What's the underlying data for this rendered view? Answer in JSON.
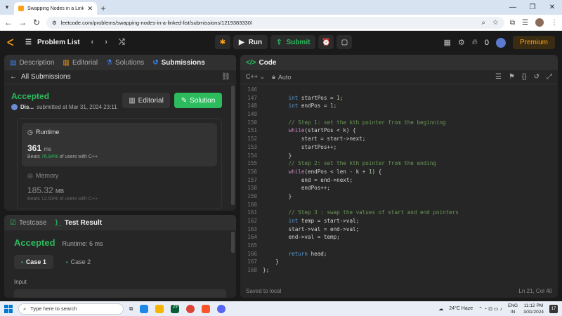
{
  "browser": {
    "tab_title": "Swapping Nodes in a Linked Lis",
    "url": "leetcode.com/problems/swapping-nodes-in-a-linked-list/submissions/1219383330/"
  },
  "topbar": {
    "problem_list": "Problem List",
    "run": "Run",
    "submit": "Submit",
    "streak": "0",
    "premium": "Premium"
  },
  "left_tabs": [
    "Description",
    "Editorial",
    "Solutions",
    "Submissions"
  ],
  "submission": {
    "all_label": "All Submissions",
    "status": "Accepted",
    "user": "Dis...",
    "submitted": "submitted at Mar 31, 2024 23:11",
    "editorial_btn": "Editorial",
    "solution_btn": "Solution",
    "runtime_label": "Runtime",
    "runtime_value": "361",
    "runtime_unit": "ms",
    "runtime_beats_pre": "Beats",
    "runtime_beats": "76.84%",
    "runtime_beats_post": "of users with C++",
    "memory_label": "Memory",
    "memory_value": "185.32",
    "memory_unit": "MB",
    "memory_beats_pre": "Beats",
    "memory_beats": "12.63%",
    "memory_beats_post": "of users with C++"
  },
  "bottom": {
    "tab_testcase": "Testcase",
    "tab_result": "Test Result",
    "status": "Accepted",
    "runtime": "Runtime: 6 ms",
    "case1": "Case 1",
    "case2": "Case 2",
    "input_label": "Input"
  },
  "code_panel": {
    "title": "Code",
    "language": "C++",
    "mode": "Auto",
    "saved": "Saved to local",
    "cursor": "Ln 21, Col 40",
    "lines": [
      {
        "n": "146",
        "t": ""
      },
      {
        "n": "147",
        "t": "        int startPos = 1;"
      },
      {
        "n": "148",
        "t": "        int endPos = 1;"
      },
      {
        "n": "149",
        "t": ""
      },
      {
        "n": "150",
        "t": "        // Step 1: set the kth pointer from the beginning"
      },
      {
        "n": "151",
        "t": "        while(startPos < k) {"
      },
      {
        "n": "152",
        "t": "            start = start->next;"
      },
      {
        "n": "153",
        "t": "            startPos++;"
      },
      {
        "n": "154",
        "t": "        }"
      },
      {
        "n": "155",
        "t": "        // Step 2: set the kth pointer from the ending"
      },
      {
        "n": "156",
        "t": "        while(endPos < len - k + 1) {"
      },
      {
        "n": "157",
        "t": "            end = end->next;"
      },
      {
        "n": "158",
        "t": "            endPos++;"
      },
      {
        "n": "159",
        "t": "        }"
      },
      {
        "n": "160",
        "t": ""
      },
      {
        "n": "161",
        "t": "        // Step 3 : swap the values of start and end pointers"
      },
      {
        "n": "162",
        "t": "        int temp = start->val;"
      },
      {
        "n": "163",
        "t": "        start->val = end->val;"
      },
      {
        "n": "164",
        "t": "        end->val = temp;"
      },
      {
        "n": "165",
        "t": ""
      },
      {
        "n": "166",
        "t": "        return head;"
      },
      {
        "n": "167",
        "t": "    }"
      },
      {
        "n": "168",
        "t": "};"
      }
    ]
  },
  "taskbar": {
    "search_placeholder": "Type here to search",
    "badge": "29",
    "weather": "24°C  Haze",
    "lang1": "ENG",
    "lang2": "IN",
    "time": "11:12 PM",
    "date": "3/31/2024",
    "notifications": "17"
  }
}
